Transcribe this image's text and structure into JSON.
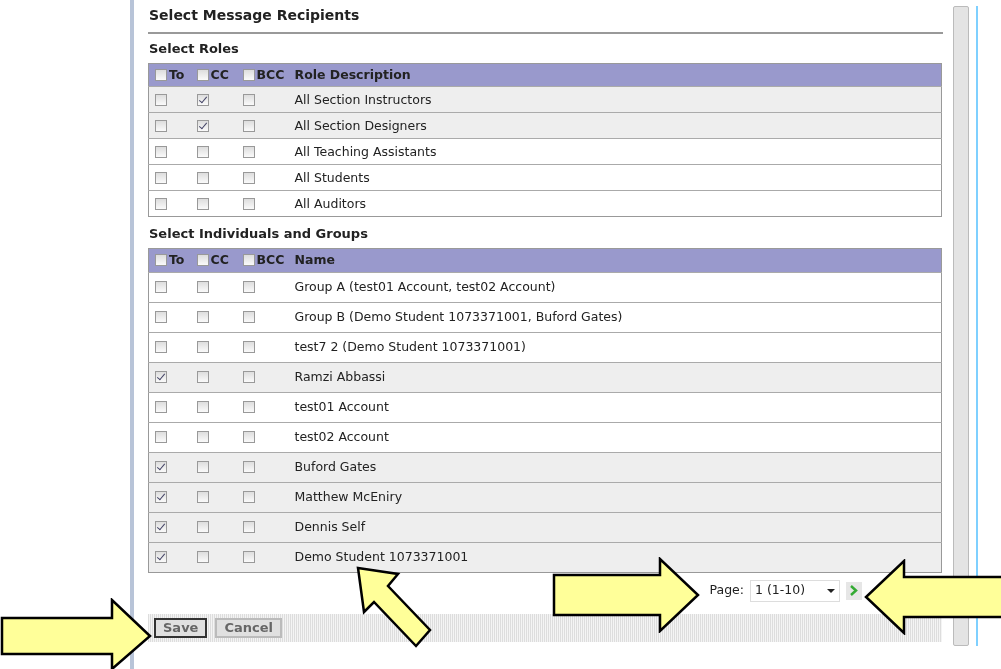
{
  "title": "Select Message Recipients",
  "sections": [
    {
      "title": "Select Roles",
      "columns": [
        {
          "label": "To",
          "checked": false
        },
        {
          "label": "CC",
          "checked": false
        },
        {
          "label": "BCC",
          "checked": false
        },
        {
          "label": "Role Description"
        }
      ],
      "rows": [
        {
          "name": "All Section Instructors",
          "to": false,
          "cc": true,
          "bcc": false
        },
        {
          "name": "All Section Designers",
          "to": false,
          "cc": true,
          "bcc": false
        },
        {
          "name": "All Teaching Assistants",
          "to": false,
          "cc": false,
          "bcc": false
        },
        {
          "name": "All Students",
          "to": false,
          "cc": false,
          "bcc": false
        },
        {
          "name": "All Auditors",
          "to": false,
          "cc": false,
          "bcc": false
        }
      ]
    },
    {
      "title": "Select Individuals and Groups",
      "columns": [
        {
          "label": "To",
          "checked": false
        },
        {
          "label": "CC",
          "checked": false
        },
        {
          "label": "BCC",
          "checked": false
        },
        {
          "label": "Name"
        }
      ],
      "rows": [
        {
          "name": "Group A (test01 Account, test02 Account)",
          "to": false,
          "cc": false,
          "bcc": false
        },
        {
          "name": "Group B (Demo Student 1073371001, Buford Gates)",
          "to": false,
          "cc": false,
          "bcc": false
        },
        {
          "name": "test7 2 (Demo Student 1073371001)",
          "to": false,
          "cc": false,
          "bcc": false
        },
        {
          "name": "Ramzi Abbassi",
          "to": true,
          "cc": false,
          "bcc": false
        },
        {
          "name": "test01 Account",
          "to": false,
          "cc": false,
          "bcc": false
        },
        {
          "name": "test02 Account",
          "to": false,
          "cc": false,
          "bcc": false
        },
        {
          "name": "Buford Gates",
          "to": true,
          "cc": false,
          "bcc": false
        },
        {
          "name": "Matthew McEniry",
          "to": true,
          "cc": false,
          "bcc": false
        },
        {
          "name": "Dennis Self",
          "to": true,
          "cc": false,
          "bcc": false
        },
        {
          "name": "Demo Student 1073371001",
          "to": true,
          "cc": false,
          "bcc": false
        }
      ]
    }
  ],
  "pager": {
    "label": "Page:",
    "value": "1 (1-10)"
  },
  "buttons": [
    {
      "label": "Save",
      "focused": true
    },
    {
      "label": "Cancel",
      "focused": false
    }
  ]
}
